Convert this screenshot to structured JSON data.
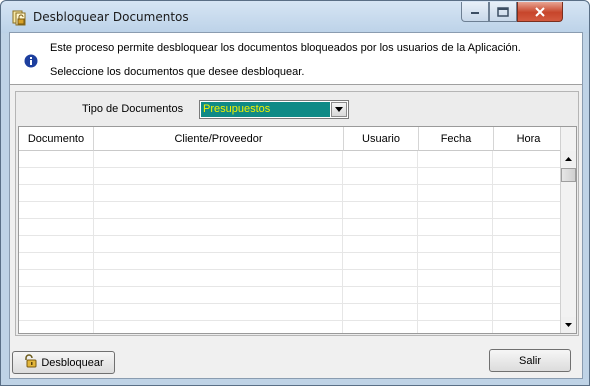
{
  "window": {
    "title": "Desbloquear Documentos"
  },
  "info": {
    "line1": "Este proceso permite desbloquear los documentos bloqueados por los usuarios de la Aplicación.",
    "line2": "Seleccione los documentos que desee desbloquear."
  },
  "filter": {
    "label": "Tipo de Documentos",
    "selected": "Presupuestos",
    "highlight_bg": "#0f8a86",
    "highlight_fg": "#f2f200"
  },
  "grid": {
    "columns": [
      "Documento",
      "Cliente/Proveedor",
      "Usuario",
      "Fecha",
      "Hora"
    ],
    "rows": []
  },
  "buttons": {
    "unlock_label": "Desbloquear",
    "exit_label": "Salir"
  },
  "icons": {
    "app": "documents-unlock-icon",
    "info": "info-icon",
    "unlock": "padlock-open-icon"
  }
}
